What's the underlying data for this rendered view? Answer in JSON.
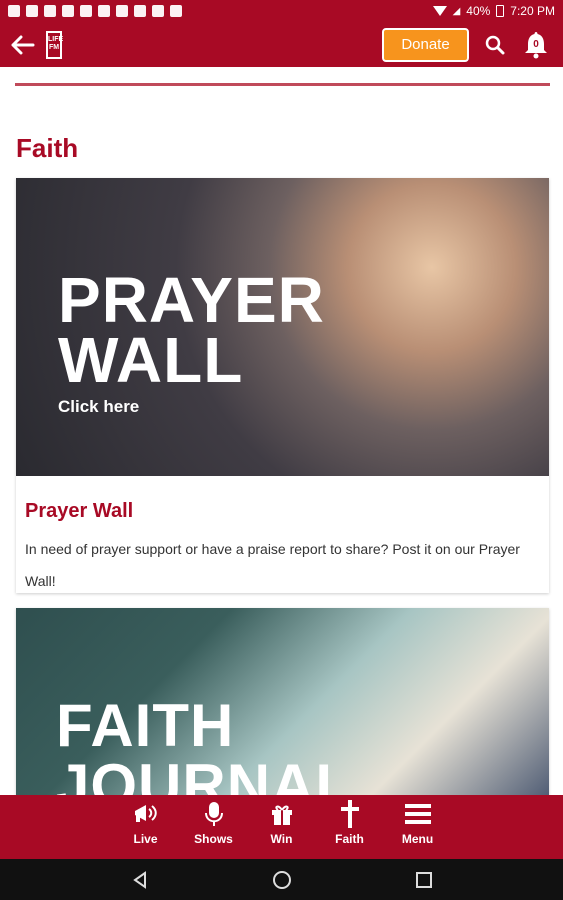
{
  "status": {
    "battery": "40%",
    "time": "7:20 PM"
  },
  "appbar": {
    "logo": "LIFE FM",
    "donate_label": "Donate",
    "notification_count": "0"
  },
  "section": {
    "title": "Faith"
  },
  "cards": [
    {
      "image_title_line1": "PRAYER",
      "image_title_line2": "WALL",
      "image_sub": "Click here",
      "title": "Prayer Wall",
      "description": "In need of prayer support or have a praise report to share? Post it on our Prayer Wall!"
    },
    {
      "image_title_line1": "FAITH",
      "image_title_line2": "JOURNAL"
    }
  ],
  "nav": {
    "items": [
      {
        "label": "Live",
        "icon": "megaphone-icon"
      },
      {
        "label": "Shows",
        "icon": "microphone-icon"
      },
      {
        "label": "Win",
        "icon": "gift-icon"
      },
      {
        "label": "Faith",
        "icon": "cross-icon"
      },
      {
        "label": "Menu",
        "icon": "menu-icon"
      }
    ]
  },
  "colors": {
    "brand": "#a80a25",
    "donate": "#f7941d"
  }
}
